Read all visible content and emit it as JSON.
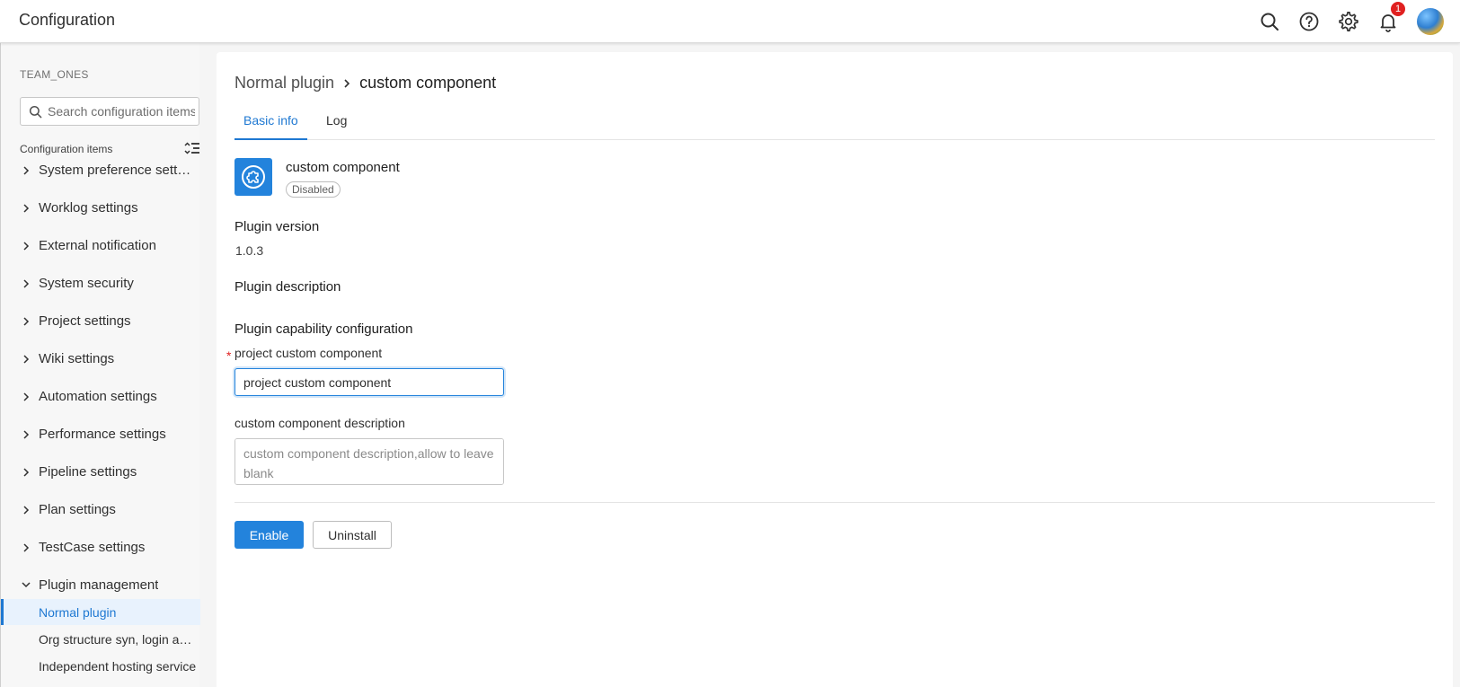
{
  "header": {
    "title": "Configuration",
    "notification_count": "1",
    "icons": [
      "search-icon",
      "help-icon",
      "gear-icon",
      "bell-icon",
      "avatar"
    ]
  },
  "sidebar": {
    "team": "TEAM_ONES",
    "search_placeholder": "Search configuration items",
    "section_label": "Configuration items",
    "items": [
      {
        "label": "System preference settings"
      },
      {
        "label": "Worklog settings"
      },
      {
        "label": "External notification"
      },
      {
        "label": "System security"
      },
      {
        "label": "Project settings"
      },
      {
        "label": "Wiki settings"
      },
      {
        "label": "Automation settings"
      },
      {
        "label": "Performance settings"
      },
      {
        "label": "Pipeline settings"
      },
      {
        "label": "Plan settings"
      },
      {
        "label": "TestCase settings"
      },
      {
        "label": "Plugin management"
      }
    ],
    "sub_items": [
      {
        "label": "Normal plugin",
        "active": true
      },
      {
        "label": "Org structure syn, login authentication"
      },
      {
        "label": "Independent hosting service"
      }
    ]
  },
  "main": {
    "breadcrumb": {
      "parent": "Normal plugin",
      "current": "custom component"
    },
    "tabs": [
      {
        "label": "Basic info",
        "active": true
      },
      {
        "label": "Log"
      }
    ],
    "plugin": {
      "name": "custom component",
      "status": "Disabled"
    },
    "version_title": "Plugin version",
    "version_value": "1.0.3",
    "description_title": "Plugin description",
    "capability_title": "Plugin capability configuration",
    "fields": {
      "component_label": "project custom component",
      "component_value": "project custom component",
      "description_label": "custom component description",
      "description_placeholder": "custom component description,allow to leave blank"
    },
    "buttons": {
      "enable": "Enable",
      "uninstall": "Uninstall"
    }
  },
  "colors": {
    "accent": "#2383dc",
    "active_bg": "#e8f2fd",
    "badge": "#e02020"
  }
}
